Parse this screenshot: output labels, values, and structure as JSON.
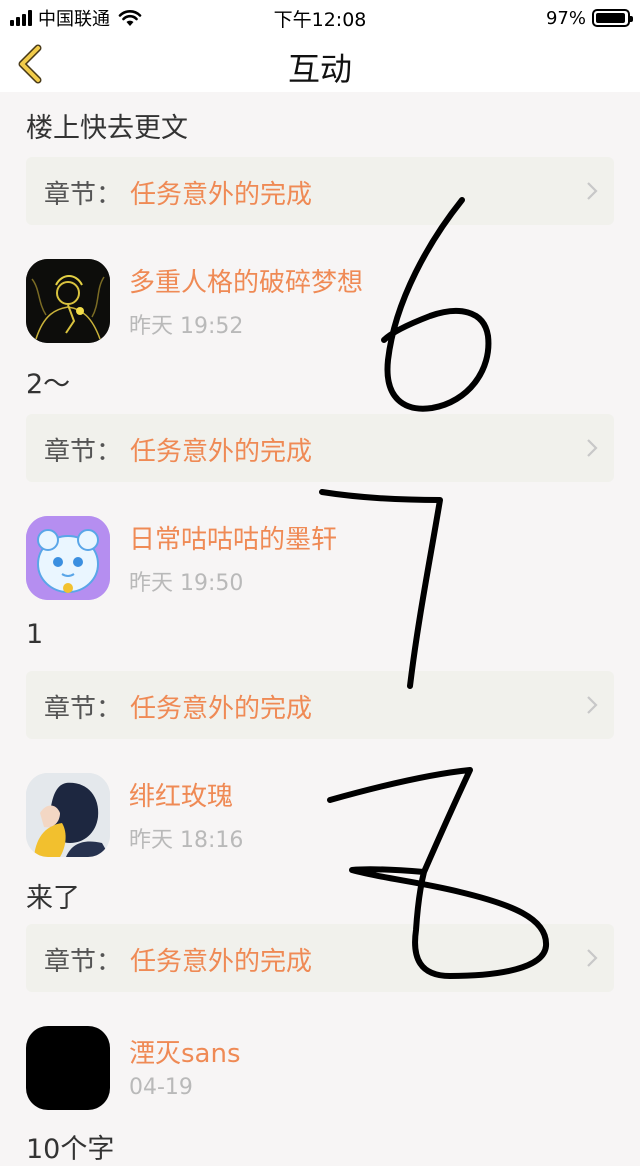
{
  "status_bar": {
    "carrier": "中国联通",
    "time": "下午12:08",
    "battery": "97%",
    "battery_level": 0.97
  },
  "nav": {
    "title": "互动",
    "back_icon": "chevron-left-icon"
  },
  "top_comment": "楼上快去更文",
  "chapter_prefix": "章节：",
  "chapter_title": "任务意外的完成",
  "items": [
    {
      "username": "多重人格的破碎梦想",
      "time": "昨天 19:52",
      "comment": "2～"
    },
    {
      "username": "日常咕咕咕的墨轩",
      "time": "昨天 19:50",
      "comment": "1"
    },
    {
      "username": "绯红玫瑰",
      "time": "昨天 18:16",
      "comment": "来了"
    },
    {
      "username": "湮灭sans",
      "time": "04-19",
      "comment": "10个字"
    }
  ],
  "colors": {
    "accent": "#ef8a55",
    "card_bg": "#f1f1ec",
    "time_gray": "#b9b9b9"
  }
}
